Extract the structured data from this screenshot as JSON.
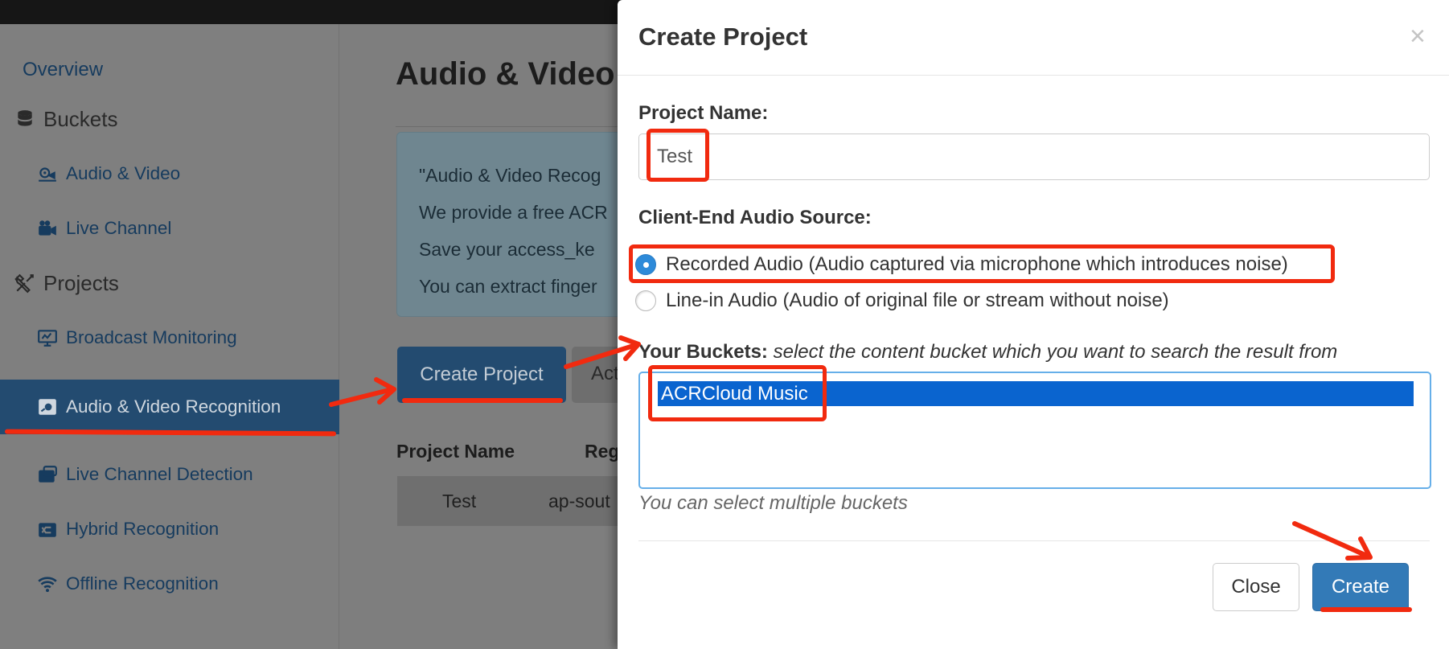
{
  "sidebar": {
    "items": [
      {
        "label": "Overview",
        "icon": "none"
      },
      {
        "label": "Buckets",
        "icon": "database-icon"
      },
      {
        "label": "Audio & Video",
        "icon": "film-reel-icon"
      },
      {
        "label": "Live Channel",
        "icon": "live-camera-icon"
      },
      {
        "label": "Projects",
        "icon": "tools-icon"
      },
      {
        "label": "Broadcast Monitoring",
        "icon": "monitor-icon"
      },
      {
        "label": "Audio & Video Recognition",
        "icon": "recognition-icon"
      },
      {
        "label": "Live Channel Detection",
        "icon": "live-detect-icon"
      },
      {
        "label": "Hybrid Recognition",
        "icon": "shuffle-icon"
      },
      {
        "label": "Offline Recognition",
        "icon": "wifi-icon"
      }
    ]
  },
  "main": {
    "title": "Audio & Video",
    "info_lines": [
      "\"Audio & Video Recog",
      "We provide a free ACR",
      "Save your access_ke",
      "You can extract finger"
    ],
    "create_button": "Create Project",
    "second_button": "Act",
    "table": {
      "headers": [
        "Project Name",
        "Reg"
      ],
      "rows": [
        [
          "Test",
          "ap-sout"
        ]
      ]
    }
  },
  "modal": {
    "title": "Create Project",
    "close_symbol": "×",
    "project_name_label": "Project Name:",
    "project_name_value": "Test",
    "audio_source_label": "Client-End Audio Source:",
    "audio_options": [
      {
        "label": "Recorded Audio (Audio captured via microphone which introduces noise)",
        "checked": true
      },
      {
        "label": "Line-in Audio (Audio of original file or stream without noise)",
        "checked": false
      }
    ],
    "buckets_label_bold": "Your Buckets:",
    "buckets_label_hint": "select the content bucket which you want to search the result from",
    "bucket_options": [
      {
        "label": "ACRCloud Music",
        "selected": true
      }
    ],
    "buckets_help": "You can select multiple buckets",
    "close_button": "Close",
    "create_button": "Create"
  },
  "colors": {
    "annotation": "#f12a0f",
    "primary": "#337ab7",
    "selected_option": "#0a64cf",
    "overlay_sidebar": "#7f7f7f"
  }
}
